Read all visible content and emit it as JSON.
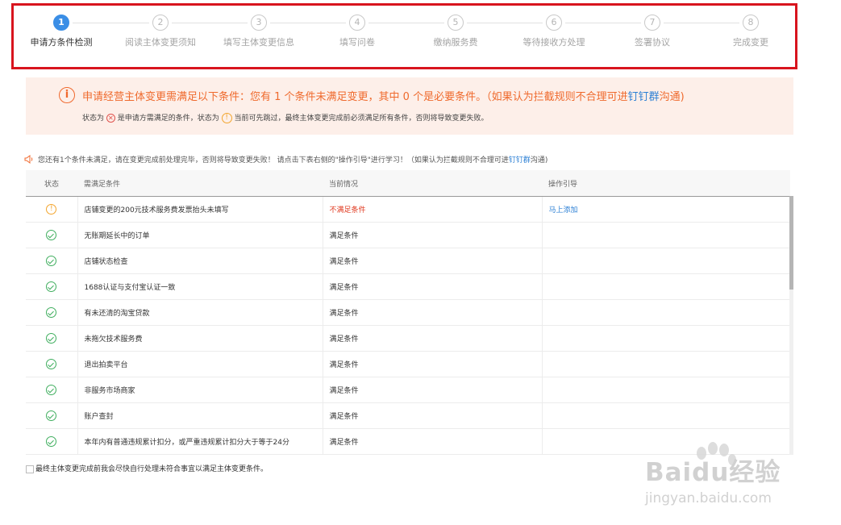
{
  "steps": [
    {
      "num": "1",
      "label": "申请方条件检测",
      "active": true
    },
    {
      "num": "2",
      "label": "阅读主体变更须知"
    },
    {
      "num": "3",
      "label": "填写主体变更信息"
    },
    {
      "num": "4",
      "label": "填写问卷"
    },
    {
      "num": "5",
      "label": "缴纳服务费"
    },
    {
      "num": "6",
      "label": "等待接收方处理"
    },
    {
      "num": "7",
      "label": "签署协议"
    },
    {
      "num": "8",
      "label": "完成变更"
    }
  ],
  "banner": {
    "icon": "i",
    "main_text": "申请经营主体变更需满足以下条件：您有 1 个条件未满足变更，其中 0 个是必要条件。（如果认为拦截规则不合理可进",
    "main_link": "钉钉群",
    "main_suffix": "沟通)",
    "sub_prefix": "状态为",
    "sub_mid": "是申请方需满足的条件，状态为",
    "sub_suffix": "当前可先跳过，最终主体变更完成前必须满足所有条件，否则将导致变更失败。"
  },
  "notice": {
    "text": "您还有1个条件未满足，请在变更完成前处理完毕，否则将导致变更失败！ 请点击下表右侧的\"操作引导\"进行学习！（如果认为拦截规则不合理可进",
    "link": "钉钉群",
    "suffix": "沟通)"
  },
  "table": {
    "headers": {
      "status": "状态",
      "condition": "需满足条件",
      "current": "当前情况",
      "guide": "操作引导"
    },
    "rows": [
      {
        "status": "warn",
        "condition": "店铺变更的200元技术服务费发票抬头未填写",
        "current": "不满足条件",
        "guide": "马上添加"
      },
      {
        "status": "ok",
        "condition": "无账期延长中的订单",
        "current": "满足条件",
        "guide": ""
      },
      {
        "status": "ok",
        "condition": "店铺状态检查",
        "current": "满足条件",
        "guide": ""
      },
      {
        "status": "ok",
        "condition": "1688认证与支付宝认证一致",
        "current": "满足条件",
        "guide": ""
      },
      {
        "status": "ok",
        "condition": "有未还清的淘宝贷款",
        "current": "满足条件",
        "guide": ""
      },
      {
        "status": "ok",
        "condition": "未拖欠技术服务费",
        "current": "满足条件",
        "guide": ""
      },
      {
        "status": "ok",
        "condition": "退出拍卖平台",
        "current": "满足条件",
        "guide": ""
      },
      {
        "status": "ok",
        "condition": "非服务市场商家",
        "current": "满足条件",
        "guide": ""
      },
      {
        "status": "ok",
        "condition": "账户查封",
        "current": "满足条件",
        "guide": ""
      },
      {
        "status": "ok",
        "condition": "本年内有普通违规累计扣分，或严重违规累计扣分大于等于24分",
        "current": "满足条件",
        "guide": ""
      }
    ]
  },
  "agree_text": "最终主体变更完成前我会尽快自行处理未符合事宜以满足主体变更条件。",
  "watermark": {
    "brand": "Baidu经验",
    "url": "jingyan.baidu.com"
  },
  "colors": {
    "accent": "#3a8ee6",
    "highlight_frame": "#d8141e",
    "warning": "#ef6a2d",
    "success": "#3fae5e",
    "error": "#e0391f"
  }
}
